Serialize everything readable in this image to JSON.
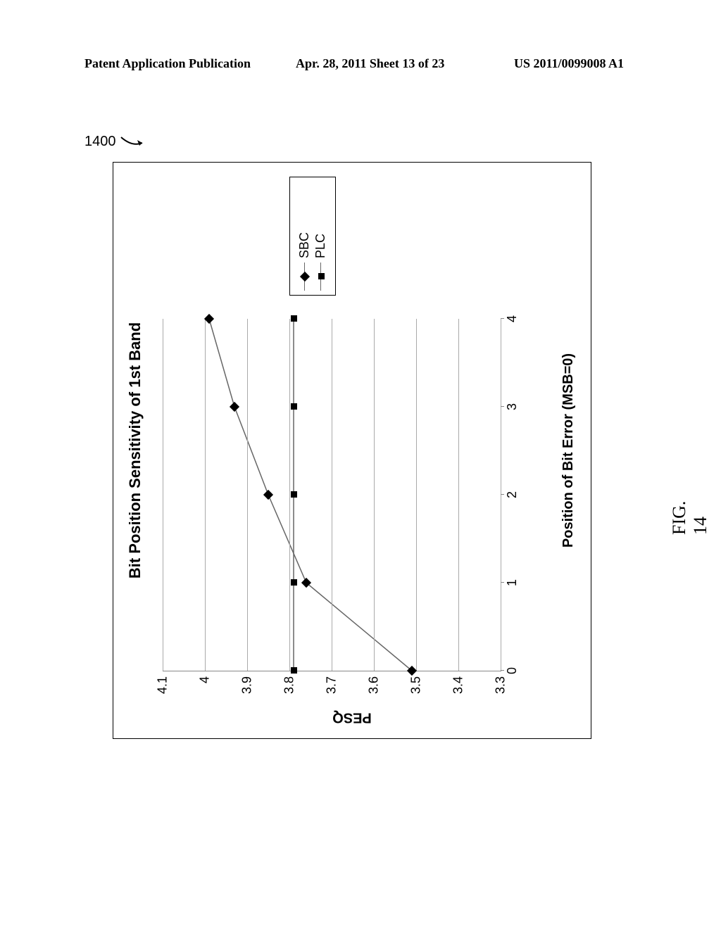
{
  "header": {
    "left": "Patent Application Publication",
    "mid": "Apr. 28, 2011  Sheet 13 of 23",
    "right": "US 2011/0099008 A1"
  },
  "figure_ref": "1400",
  "figure_caption": "FIG. 14",
  "chart_data": {
    "type": "line",
    "title": "Bit Position Sensitivity of 1st Band",
    "xlabel": "Position of Bit Error (MSB=0)",
    "ylabel": "PESQ",
    "xlim": [
      0,
      4
    ],
    "ylim": [
      3.3,
      4.1
    ],
    "xticks": [
      0,
      1,
      2,
      3,
      4
    ],
    "yticks": [
      3.3,
      3.4,
      3.5,
      3.6,
      3.7,
      3.8,
      3.9,
      4,
      4.1
    ],
    "legend_position": "right",
    "series": [
      {
        "name": "SBC",
        "marker": "diamond",
        "x": [
          0,
          1,
          2,
          3,
          4
        ],
        "values": [
          3.51,
          3.76,
          3.85,
          3.93,
          3.99
        ]
      },
      {
        "name": "PLC",
        "marker": "square",
        "x": [
          0,
          1,
          2,
          3,
          4
        ],
        "values": [
          3.79,
          3.79,
          3.79,
          3.79,
          3.79
        ]
      }
    ]
  }
}
